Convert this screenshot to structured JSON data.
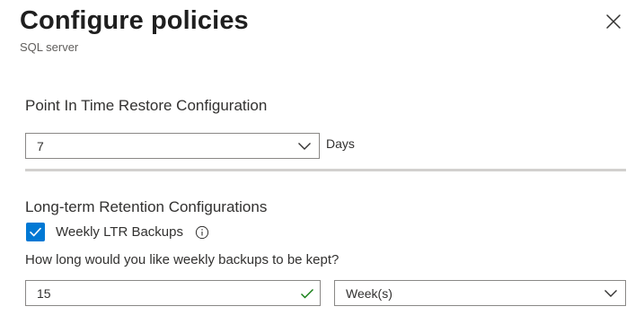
{
  "header": {
    "title": "Configure policies",
    "subtitle": "SQL server",
    "close_icon": "close-icon"
  },
  "pitr": {
    "heading": "Point In Time Restore Configuration",
    "retention_value": "7",
    "unit_label": "Days"
  },
  "ltr": {
    "heading": "Long-term Retention Configurations",
    "weekly_checkbox_label": "Weekly LTR Backups",
    "weekly_checked": true,
    "question": "How long would you like weekly backups to be kept?",
    "weekly_value": "15",
    "weekly_unit": "Week(s)"
  },
  "colors": {
    "accent": "#0078d4",
    "valid": "#107c10",
    "border": "#8a8886",
    "separator": "#d2d0ce"
  }
}
